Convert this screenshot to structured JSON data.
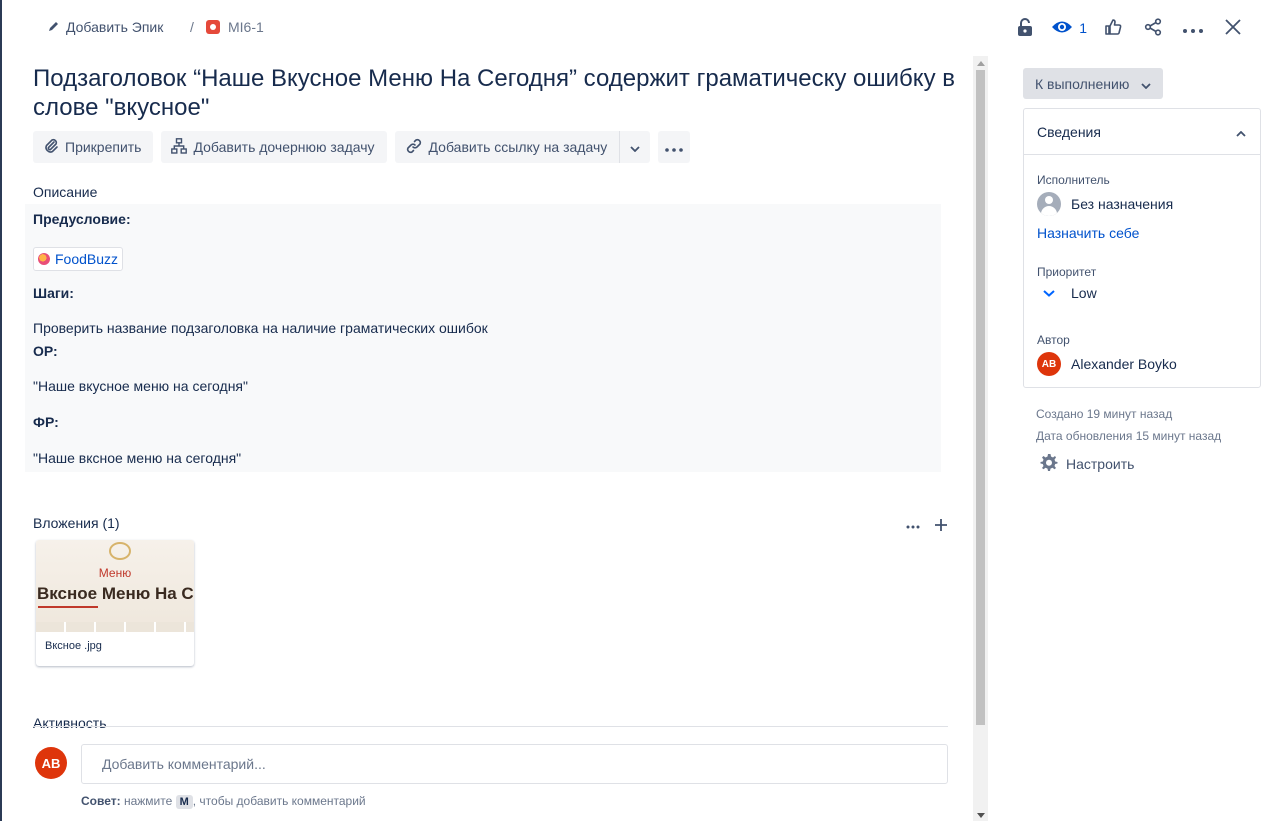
{
  "breadcrumb": {
    "epic_label": "Добавить Эпик",
    "separator": "/",
    "issue_key": "MI6-1"
  },
  "top_actions": {
    "watch_count": "1"
  },
  "issue": {
    "title": "Подзаголовок “Наше Вкусное Меню На Сегодня” содержит граматическу ошибку в слове \"вкусное\""
  },
  "toolbar": {
    "attach_label": "Прикрепить",
    "child_task_label": "Добавить дочернюю задачу",
    "link_task_label": "Добавить ссылку на задачу"
  },
  "description": {
    "label": "Описание",
    "precondition_label": "Предусловие:",
    "link_chip": "FoodBuzz",
    "steps_label": "Шаги:",
    "step_text": "Проверить название подзаголовка на наличие граматических ошибок",
    "expected_label": "ОР:",
    "expected_text": "\"Наше вкусное меню на сегодня\"",
    "actual_label": "ФР:",
    "actual_text": "\"Наше вксное меню на сегодня\""
  },
  "attachments": {
    "label": "Вложения (1)",
    "file": {
      "name": "Вксное .jpg",
      "preview_subtitle": "Меню",
      "preview_heading": "Вксное Меню На С"
    }
  },
  "activity": {
    "label": "Активность",
    "avatar_initials": "AB",
    "comment_placeholder": "Добавить комментарий...",
    "tip_prefix": "Совет:",
    "tip_text_before": " нажмите ",
    "tip_key": "M",
    "tip_text_after": ", чтобы добавить комментарий"
  },
  "sidebar": {
    "status_label": "К выполнению",
    "details_title": "Сведения",
    "assignee_label": "Исполнитель",
    "assignee_value": "Без назначения",
    "assign_self": "Назначить себе",
    "priority_label": "Приоритет",
    "priority_value": "Low",
    "author_label": "Автор",
    "author_initials": "AB",
    "author_name": "Alexander Boyko",
    "created": "Создано 19 минут назад",
    "updated": "Дата обновления 15 минут назад",
    "configure_label": "Настроить"
  },
  "colors": {
    "accent": "#0052cc",
    "avatar": "#de350b",
    "bug": "#e5493a",
    "priority_low": "#0065ff"
  }
}
